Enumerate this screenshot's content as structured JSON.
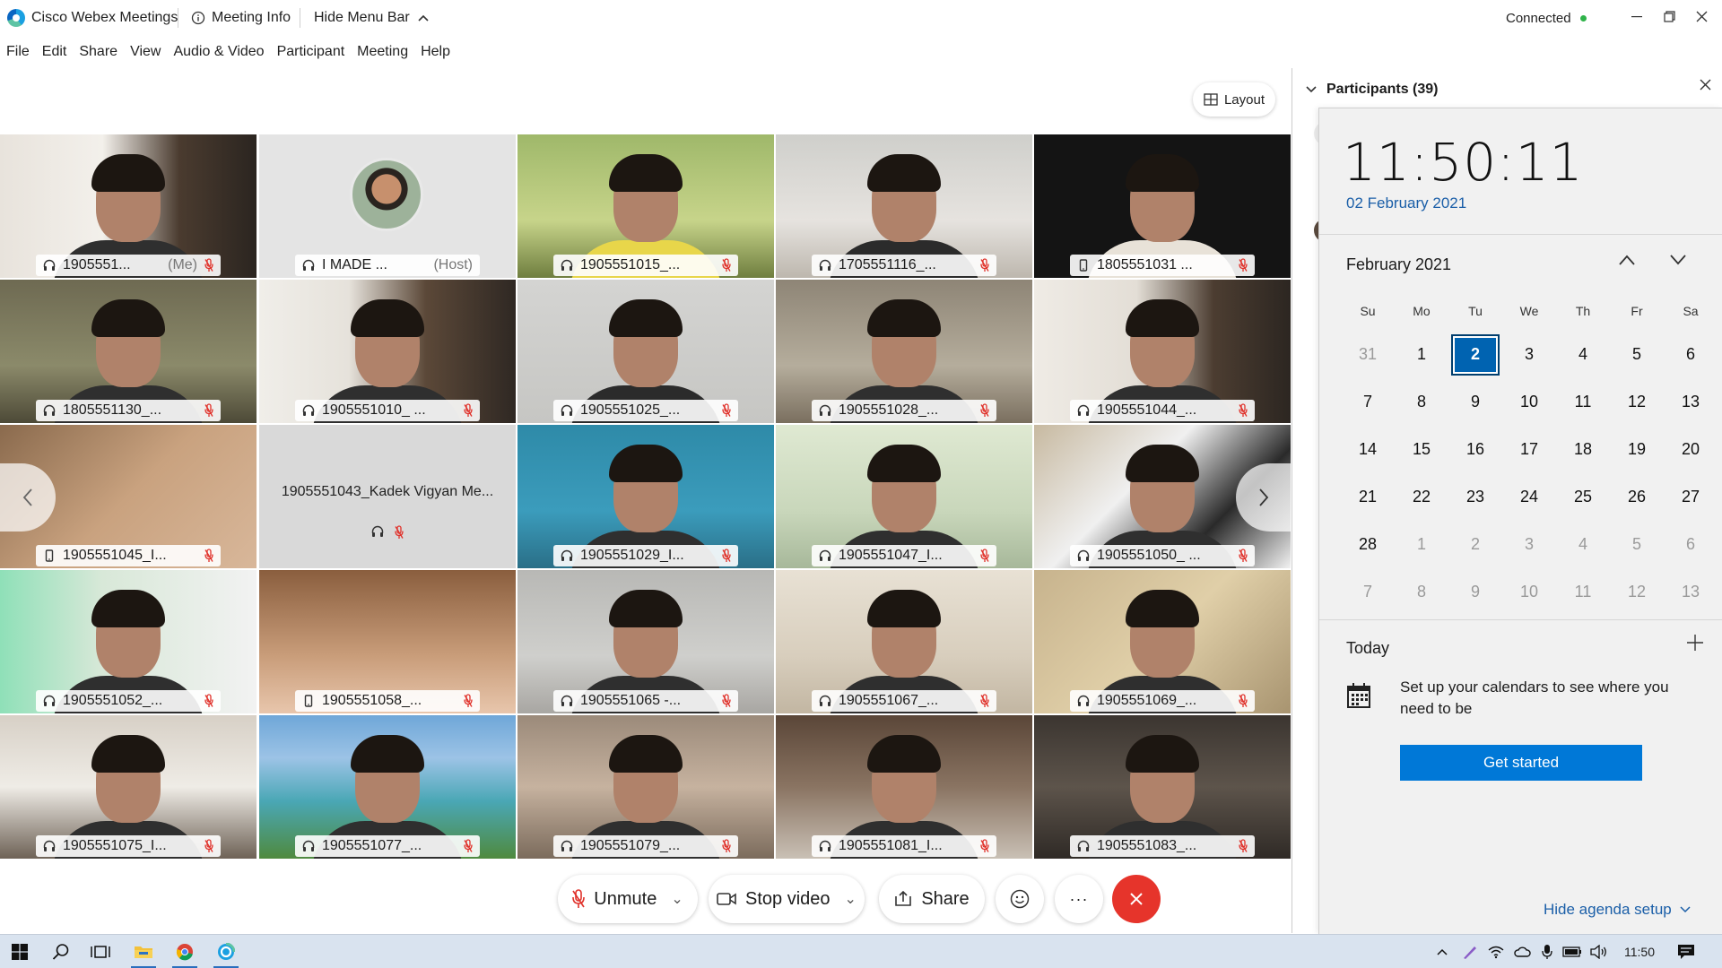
{
  "titlebar": {
    "app_name": "Cisco Webex Meetings",
    "meeting_info": "Meeting Info",
    "hide_menu_bar": "Hide Menu Bar",
    "connection_status": "Connected",
    "status_color": "#2fb34a"
  },
  "menu": [
    "File",
    "Edit",
    "Share",
    "View",
    "Audio & Video",
    "Participant",
    "Meeting",
    "Help"
  ],
  "layout_button": "Layout",
  "tiles": [
    {
      "name": "1905551...",
      "tag": "(Me)",
      "device": "headset",
      "muted": true
    },
    {
      "name": "I MADE ...",
      "tag": "(Host)",
      "device": "headset",
      "muted": false
    },
    {
      "name": "1905551015_...",
      "tag": "",
      "device": "headset",
      "muted": true
    },
    {
      "name": "1705551116_...",
      "tag": "",
      "device": "headset",
      "muted": true
    },
    {
      "name": "1805551031 ...",
      "tag": "",
      "device": "phone",
      "muted": true
    },
    {
      "name": "1805551130_...",
      "tag": "",
      "device": "headset",
      "muted": true
    },
    {
      "name": "1905551010_ ...",
      "tag": "",
      "device": "headset",
      "muted": true
    },
    {
      "name": "1905551025_...",
      "tag": "",
      "device": "headset",
      "muted": true
    },
    {
      "name": "1905551028_...",
      "tag": "",
      "device": "headset",
      "muted": true
    },
    {
      "name": "1905551044_...",
      "tag": "",
      "device": "headset",
      "muted": true
    },
    {
      "name": "1905551045_I...",
      "tag": "",
      "device": "phone",
      "muted": true
    },
    {
      "name": "1905551043_Kadek Vigyan Me...",
      "tag": "",
      "device": "headset",
      "muted": true
    },
    {
      "name": "1905551029_I...",
      "tag": "",
      "device": "headset",
      "muted": true
    },
    {
      "name": "1905551047_I...",
      "tag": "",
      "device": "headset",
      "muted": true
    },
    {
      "name": "1905551050_ ...",
      "tag": "",
      "device": "headset",
      "muted": true
    },
    {
      "name": "1905551052_...",
      "tag": "",
      "device": "headset",
      "muted": true
    },
    {
      "name": "1905551058_...",
      "tag": "",
      "device": "phone",
      "muted": true
    },
    {
      "name": "1905551065 -...",
      "tag": "",
      "device": "headset",
      "muted": true
    },
    {
      "name": "1905551067_...",
      "tag": "",
      "device": "headset",
      "muted": true
    },
    {
      "name": "1905551069_...",
      "tag": "",
      "device": "headset",
      "muted": true
    },
    {
      "name": "1905551075_I...",
      "tag": "",
      "device": "headset",
      "muted": true
    },
    {
      "name": "1905551077_...",
      "tag": "",
      "device": "headset",
      "muted": true
    },
    {
      "name": "1905551079_...",
      "tag": "",
      "device": "headset",
      "muted": true
    },
    {
      "name": "1905551081_I...",
      "tag": "",
      "device": "headset",
      "muted": true
    },
    {
      "name": "1905551083_...",
      "tag": "",
      "device": "headset",
      "muted": true
    }
  ],
  "controls": {
    "unmute": "Unmute",
    "stop_video": "Stop video",
    "share": "Share",
    "more": "···"
  },
  "participants": {
    "title": "Participants (39)"
  },
  "calendar": {
    "time": "11:50:11",
    "date": "02 February 2021",
    "month_label": "February 2021",
    "weekdays": [
      "Su",
      "Mo",
      "Tu",
      "We",
      "Th",
      "Fr",
      "Sa"
    ],
    "weeks": [
      [
        "31",
        "1",
        "2",
        "3",
        "4",
        "5",
        "6"
      ],
      [
        "7",
        "8",
        "9",
        "10",
        "11",
        "12",
        "13"
      ],
      [
        "14",
        "15",
        "16",
        "17",
        "18",
        "19",
        "20"
      ],
      [
        "21",
        "22",
        "23",
        "24",
        "25",
        "26",
        "27"
      ],
      [
        "28",
        "1",
        "2",
        "3",
        "4",
        "5",
        "6"
      ],
      [
        "7",
        "8",
        "9",
        "10",
        "11",
        "12",
        "13"
      ]
    ],
    "selected_day": "2",
    "today_label": "Today",
    "agenda_text": "Set up your calendars to see where you need to be",
    "get_started": "Get started",
    "hide_agenda": "Hide agenda setup"
  },
  "taskbar": {
    "clock": "11:50"
  }
}
